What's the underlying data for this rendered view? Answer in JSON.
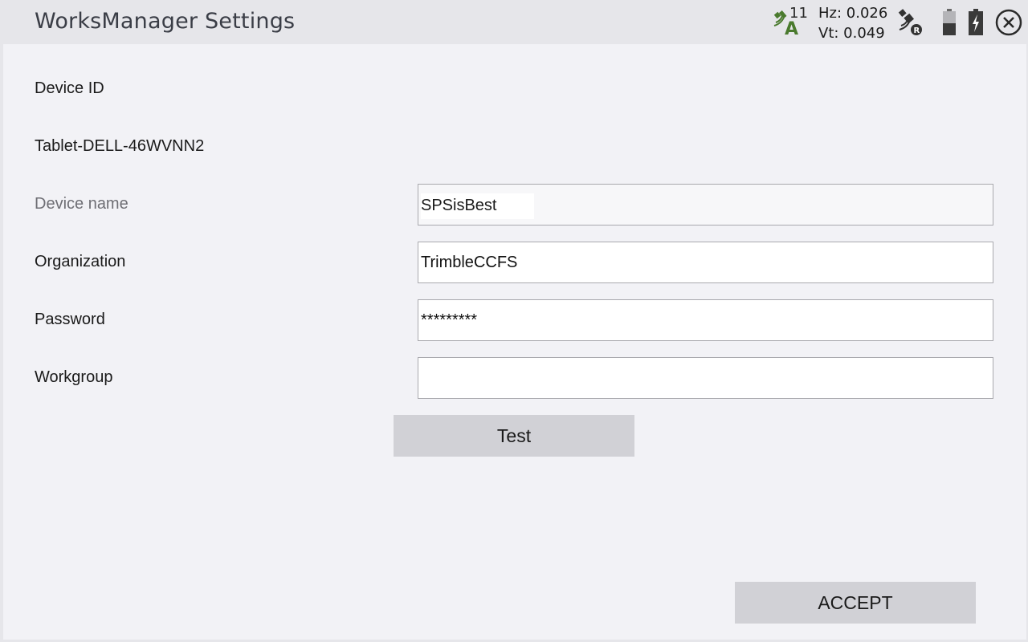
{
  "window": {
    "title": "WorksManager Settings"
  },
  "status": {
    "satellite_count": "11",
    "hz": "Hz: 0.026",
    "vt": "Vt: 0.049",
    "icons": [
      "satellite-autonomous-icon",
      "rover-radio-icon",
      "battery-icon",
      "battery-charging-icon",
      "close-icon"
    ],
    "accent": "#4a7a2e"
  },
  "form": {
    "device_id_label": "Device ID",
    "device_id_value": "Tablet-DELL-46WVNN2",
    "device_name_label": "Device name",
    "device_name_value": "SPSisBest",
    "organization_label": "Organization",
    "organization_value": "TrimbleCCFS",
    "password_label": "Password",
    "password_value": "*********",
    "workgroup_label": "Workgroup",
    "workgroup_value": ""
  },
  "buttons": {
    "test_label": "Test",
    "accept_label": "ACCEPT"
  }
}
